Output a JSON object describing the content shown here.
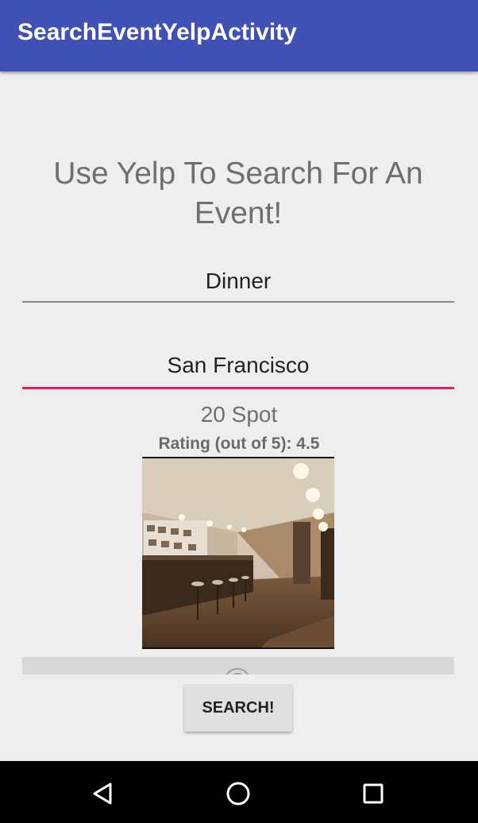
{
  "appbar": {
    "title": "SearchEventYelpActivity"
  },
  "heading": "Use Yelp To Search For An Event!",
  "fields": {
    "term": {
      "value": "Dinner"
    },
    "location": {
      "value": "San Francisco"
    }
  },
  "result": {
    "name": "20 Spot",
    "rating_text": "Rating (out of 5): 4.5"
  },
  "search_button": {
    "label": "SEARCH!"
  },
  "navbar": {
    "back_icon": "back-triangle",
    "home_icon": "home-circle",
    "recents_icon": "recents-square"
  },
  "colors": {
    "primary": "#3f51b5",
    "accent": "#e91e63",
    "background": "#eeeeee"
  }
}
